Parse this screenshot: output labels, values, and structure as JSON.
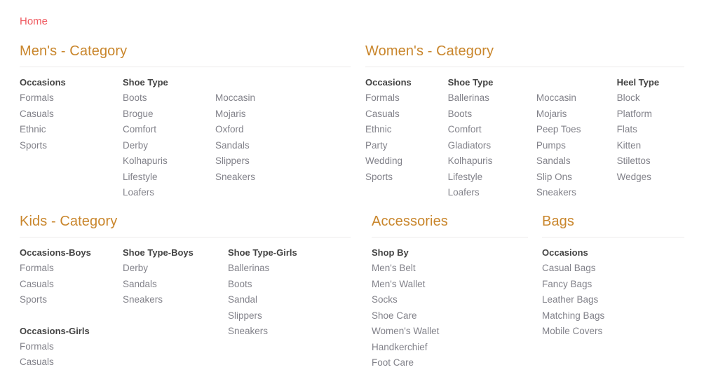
{
  "breadcrumb": {
    "items": [
      "Home"
    ]
  },
  "colors": {
    "breadcrumb_link": "#ef5a60",
    "panel_heading": "#c9862c",
    "column_heading": "#444444",
    "list_item": "#82828a",
    "rule": "#eceaea",
    "background": "#ffffff"
  },
  "panels": {
    "mens": {
      "title": "Men's - Category",
      "columns": [
        {
          "heading": "Occasions",
          "items": [
            "Formals",
            "Casuals",
            "Ethnic",
            "Sports"
          ]
        },
        {
          "heading": "Shoe Type",
          "items": [
            "Boots",
            "Brogue",
            "Comfort",
            "Derby",
            "Kolhapuris",
            "Lifestyle",
            "Loafers"
          ]
        },
        {
          "heading": "",
          "items": [
            "Moccasin",
            "Mojaris",
            "Oxford",
            "Sandals",
            "Slippers",
            "Sneakers"
          ]
        }
      ]
    },
    "womens": {
      "title": "Women's - Category",
      "columns": [
        {
          "heading": "Occasions",
          "items": [
            "Formals",
            "Casuals",
            "Ethnic",
            "Party",
            "Wedding",
            "Sports"
          ]
        },
        {
          "heading": "Shoe Type",
          "items": [
            "Ballerinas",
            "Boots",
            "Comfort",
            "Gladiators",
            "Kolhapuris",
            "Lifestyle",
            "Loafers"
          ]
        },
        {
          "heading": "",
          "items": [
            "Moccasin",
            "Mojaris",
            "Peep Toes",
            "Pumps",
            "Sandals",
            "Slip Ons",
            "Sneakers"
          ]
        },
        {
          "heading": "Heel Type",
          "items": [
            "Block",
            "Platform",
            "Flats",
            "Kitten",
            "Stilettos",
            "Wedges"
          ]
        }
      ]
    },
    "kids": {
      "title": "Kids - Category",
      "columns": [
        {
          "heading": "Occasions-Boys",
          "items": [
            "Formals",
            "Casuals",
            "Sports"
          ],
          "heading2": "Occasions-Girls",
          "items2": [
            "Formals",
            "Casuals"
          ]
        },
        {
          "heading": "Shoe Type-Boys",
          "items": [
            "Derby",
            "Sandals",
            "Sneakers"
          ]
        },
        {
          "heading": "Shoe Type-Girls",
          "items": [
            "Ballerinas",
            "Boots",
            "Sandal",
            "Slippers",
            "Sneakers"
          ]
        }
      ]
    },
    "accessories": {
      "title": "Accessories",
      "columns": [
        {
          "heading": "Shop By",
          "items": [
            "Men's Belt",
            "Men's Wallet",
            "Socks",
            "Shoe Care",
            "Women's Wallet",
            "Handkerchief",
            "Foot Care"
          ]
        }
      ]
    },
    "bags": {
      "title": "Bags",
      "columns": [
        {
          "heading": "Occasions",
          "items": [
            "Casual Bags",
            "Fancy Bags",
            "Leather Bags",
            "Matching Bags",
            "Mobile Covers"
          ]
        }
      ]
    }
  }
}
